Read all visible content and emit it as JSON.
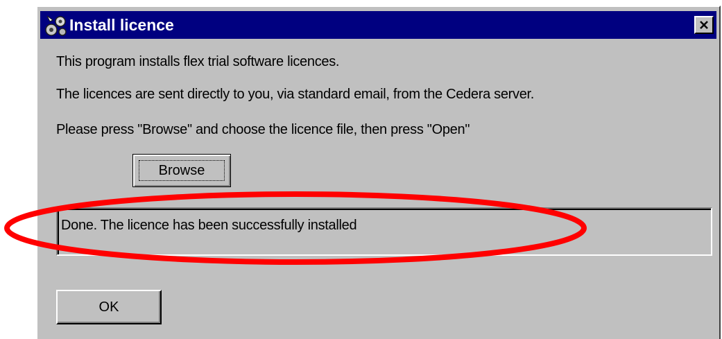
{
  "window": {
    "title": "Install licence",
    "icon": "app-icon",
    "close_icon": "close-icon"
  },
  "body": {
    "line1": "This program installs flex trial software licences.",
    "line2": "The licences are sent directly to you, via standard email, from the Cedera server.",
    "line3": "Please press \"Browse\" and choose the licence file, then press \"Open\""
  },
  "browse_button": {
    "label": "Browse"
  },
  "status": {
    "text": "Done. The licence has been successfully installed"
  },
  "ok_button": {
    "label": "OK"
  },
  "colors": {
    "titlebar": "#000080",
    "dialog_face": "#c0c0c0",
    "annotation": "#ff0000"
  }
}
